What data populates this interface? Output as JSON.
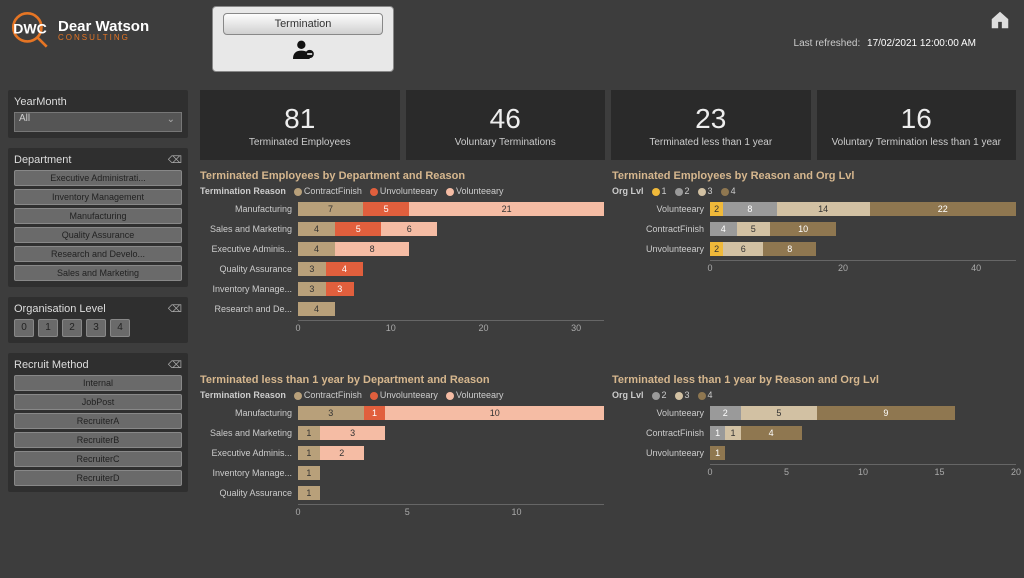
{
  "brand": {
    "name": "Dear Watson",
    "sub": "CONSULTING"
  },
  "term_card": {
    "button": "Termination"
  },
  "home": "home",
  "refreshed": {
    "label": "Last refreshed:",
    "value": "17/02/2021 12:00:00 AM"
  },
  "filters": {
    "yearmonth": {
      "title": "YearMonth",
      "value": "All"
    },
    "department": {
      "title": "Department",
      "items": [
        "Executive Administrati...",
        "Inventory Management",
        "Manufacturing",
        "Quality Assurance",
        "Research and Develo...",
        "Sales and Marketing"
      ]
    },
    "orglevel": {
      "title": "Organisation Level",
      "items": [
        "0",
        "1",
        "2",
        "3",
        "4"
      ]
    },
    "recruit": {
      "title": "Recruit Method",
      "items": [
        "Internal",
        "JobPost",
        "RecruiterA",
        "RecruiterB",
        "RecruiterC",
        "RecruiterD"
      ]
    }
  },
  "kpis": [
    {
      "value": "81",
      "label": "Terminated Employees"
    },
    {
      "value": "46",
      "label": "Voluntary Terminations"
    },
    {
      "value": "23",
      "label": "Terminated less than 1 year"
    },
    {
      "value": "16",
      "label": "Voluntary Termination less than 1 year"
    }
  ],
  "colors": {
    "contract": "#b8a07a",
    "unvol": "#e15f3d",
    "vol": "#f5bca4",
    "lvl1": "#f0b93a",
    "lvl2": "#9a9a9a",
    "lvl3": "#d2c1a3",
    "lvl4": "#8f7750"
  },
  "chart_data": [
    {
      "id": "c1",
      "title": "Terminated Employees by Department and Reason",
      "legend_label": "Termination Reason",
      "legend": [
        {
          "name": "ContractFinish",
          "color": "contract"
        },
        {
          "name": "Unvolunteeary",
          "color": "unvol"
        },
        {
          "name": "Volunteeary",
          "color": "vol"
        }
      ],
      "type": "stacked-bar-h",
      "xmax": 33,
      "ticks": [
        0,
        10,
        20,
        30
      ],
      "categories": [
        "Manufacturing",
        "Sales and Marketing",
        "Executive Adminis...",
        "Quality Assurance",
        "Inventory Manage...",
        "Research and De..."
      ],
      "series": [
        {
          "name": "ContractFinish",
          "color": "contract",
          "values": [
            7,
            4,
            4,
            3,
            3,
            4
          ]
        },
        {
          "name": "Unvolunteeary",
          "color": "unvol",
          "values": [
            5,
            5,
            0,
            4,
            3,
            0
          ]
        },
        {
          "name": "Volunteeary",
          "color": "vol",
          "values": [
            21,
            6,
            8,
            0,
            0,
            0
          ]
        }
      ]
    },
    {
      "id": "c2",
      "title": "Terminated Employees by Reason and Org Lvl",
      "legend_label": "Org Lvl",
      "legend": [
        {
          "name": "1",
          "color": "lvl1"
        },
        {
          "name": "2",
          "color": "lvl2"
        },
        {
          "name": "3",
          "color": "lvl3"
        },
        {
          "name": "4",
          "color": "lvl4"
        }
      ],
      "type": "stacked-bar-h",
      "xmax": 46,
      "ticks": [
        0,
        20,
        40
      ],
      "categories": [
        "Volunteeary",
        "ContractFinish",
        "Unvolunteeary"
      ],
      "series": [
        {
          "name": "1",
          "color": "lvl1",
          "values": [
            2,
            0,
            2
          ]
        },
        {
          "name": "2",
          "color": "lvl2",
          "values": [
            8,
            4,
            0
          ]
        },
        {
          "name": "3",
          "color": "lvl3",
          "values": [
            14,
            5,
            6
          ]
        },
        {
          "name": "4",
          "color": "lvl4",
          "values": [
            22,
            10,
            8
          ]
        }
      ]
    },
    {
      "id": "c3",
      "title": "Terminated less than 1 year by Department and Reason",
      "legend_label": "Termination Reason",
      "legend": [
        {
          "name": "ContractFinish",
          "color": "contract"
        },
        {
          "name": "Unvolunteeary",
          "color": "unvol"
        },
        {
          "name": "Volunteeary",
          "color": "vol"
        }
      ],
      "type": "stacked-bar-h",
      "xmax": 14,
      "ticks": [
        0,
        5,
        10
      ],
      "categories": [
        "Manufacturing",
        "Sales and Marketing",
        "Executive Adminis...",
        "Inventory Manage...",
        "Quality Assurance"
      ],
      "series": [
        {
          "name": "ContractFinish",
          "color": "contract",
          "values": [
            3,
            1,
            1,
            1,
            1
          ]
        },
        {
          "name": "Unvolunteeary",
          "color": "unvol",
          "values": [
            1,
            0,
            0,
            0,
            0
          ]
        },
        {
          "name": "Volunteeary",
          "color": "vol",
          "values": [
            10,
            3,
            2,
            0,
            0
          ]
        }
      ]
    },
    {
      "id": "c4",
      "title": "Terminated less than 1 year by Reason and Org Lvl",
      "legend_label": "Org Lvl",
      "legend": [
        {
          "name": "2",
          "color": "lvl2"
        },
        {
          "name": "3",
          "color": "lvl3"
        },
        {
          "name": "4",
          "color": "lvl4"
        }
      ],
      "type": "stacked-bar-h",
      "xmax": 20,
      "ticks": [
        0,
        5,
        10,
        15,
        20
      ],
      "categories": [
        "Volunteeary",
        "ContractFinish",
        "Unvolunteeary"
      ],
      "series": [
        {
          "name": "2",
          "color": "lvl2",
          "values": [
            2,
            1,
            0
          ]
        },
        {
          "name": "3",
          "color": "lvl3",
          "values": [
            5,
            1,
            0
          ]
        },
        {
          "name": "4",
          "color": "lvl4",
          "values": [
            9,
            4,
            1
          ]
        }
      ]
    }
  ]
}
